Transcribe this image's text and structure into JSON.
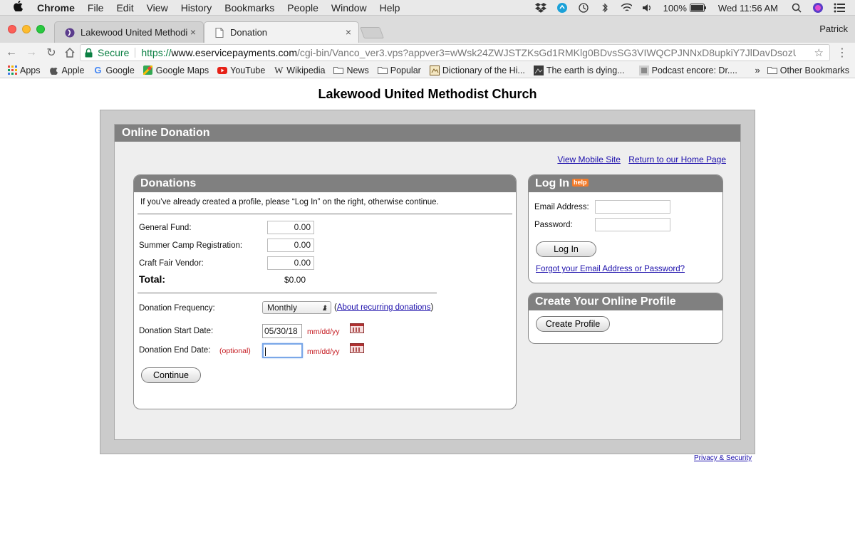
{
  "menubar": {
    "app": "Chrome",
    "items": [
      "File",
      "Edit",
      "View",
      "History",
      "Bookmarks",
      "People",
      "Window",
      "Help"
    ],
    "battery": "100%",
    "clock": "Wed 11:56 AM"
  },
  "tabs": [
    {
      "title": "Lakewood United Methodist Ch"
    },
    {
      "title": "Donation"
    }
  ],
  "profile_name": "Patrick",
  "omnibox": {
    "secure_label": "Secure",
    "url_scheme": "https://",
    "url_host": "www.eservicepayments.com",
    "url_path": "/cgi-bin/Vanco_ver3.vps?appver3=wWsk24ZWJSTZKsGd1RMKlg0BDvsSG3VIWQCPJNNxD8upkiY7JlDavDsozUE7KG0n..."
  },
  "bookmarks": {
    "items": [
      "Apps",
      "Apple",
      "Google",
      "Google Maps",
      "YouTube",
      "Wikipedia",
      "News",
      "Popular",
      "Dictionary of the Hi...",
      "The earth is dying...",
      "Podcast encore: Dr...."
    ],
    "more": "»",
    "other": "Other Bookmarks"
  },
  "page": {
    "org_title": "Lakewood United Methodist Church",
    "panel_title": "Online Donation",
    "links": {
      "mobile": "View Mobile Site",
      "home": "Return to our Home Page"
    },
    "donations": {
      "title": "Donations",
      "intro": "If you’ve already created a profile, please “Log In” on the right, otherwise continue.",
      "funds": [
        {
          "label": "General Fund:",
          "amount": "0.00"
        },
        {
          "label": "Summer Camp Registration:",
          "amount": "0.00"
        },
        {
          "label": "Craft Fair Vendor:",
          "amount": "0.00"
        }
      ],
      "total_label": "Total:",
      "total_value": "$0.00",
      "frequency_label": "Donation Frequency:",
      "frequency_value": "Monthly",
      "about_open": "(",
      "about_link": "About recurring donations",
      "about_close": ")",
      "start_label": "Donation Start Date:",
      "start_value": "05/30/18",
      "end_label": "Donation End Date:",
      "optional": "(optional)",
      "end_value": "",
      "date_format": "mm/dd/yy",
      "continue_label": "Continue"
    },
    "login": {
      "title": "Log In",
      "help": "help",
      "email_label": "Email Address:",
      "password_label": "Password:",
      "button": "Log In",
      "forgot": "Forgot your Email Address or Password?"
    },
    "create": {
      "title": "Create Your Online Profile",
      "button": "Create Profile"
    },
    "privacy": "Privacy & Security"
  }
}
